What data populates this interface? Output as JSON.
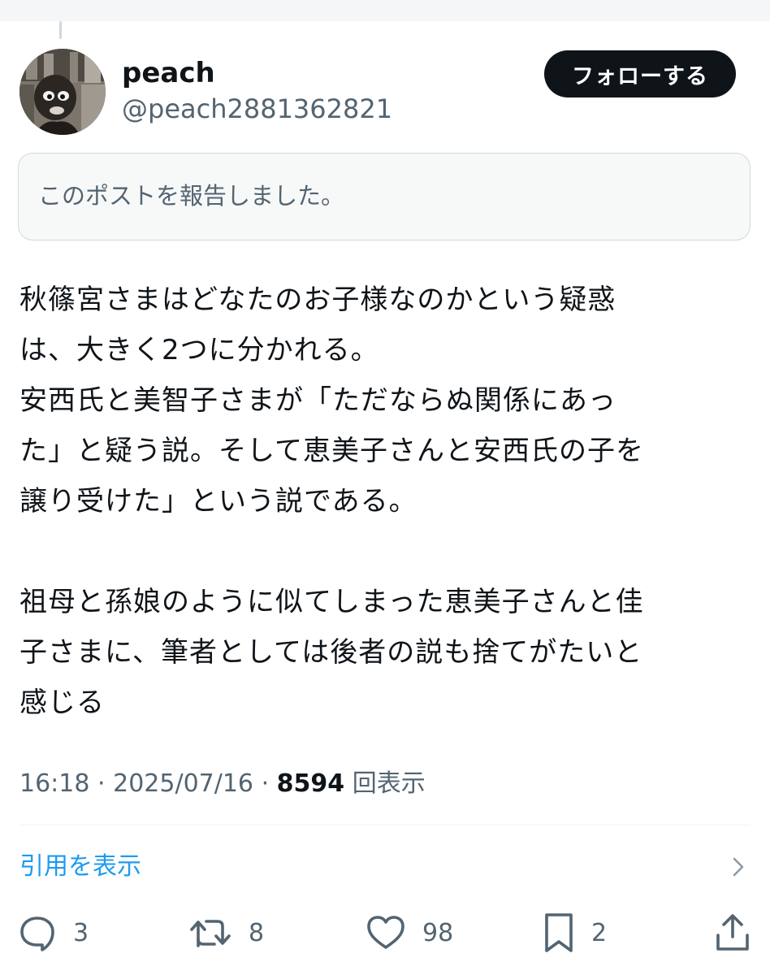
{
  "post": {
    "author": {
      "display_name": "peach",
      "handle": "@peach2881362821"
    },
    "follow_label": "フォローする",
    "report_notice": "このポストを報告しました。",
    "text_lines": [
      "秋篠宮さまはどなたのお子様なのかという疑惑",
      "は、大きく2つに分かれる。",
      "安西氏と美智子さまが「ただならぬ関係にあっ",
      "た」と疑う説。そして恵美子さんと安西氏の子を",
      "譲り受けた」という説である。",
      "",
      "祖母と孫娘のように似てしまった恵美子さんと佳",
      "子さまに、筆者としては後者の説も捨てがたいと",
      "感じる"
    ],
    "time": "16:18",
    "date": "2025/07/16",
    "separator": "·",
    "views_count": "8594",
    "views_label": "回表示",
    "quotes_label": "引用を表示"
  },
  "actions": {
    "replies": "3",
    "reposts": "8",
    "likes": "98",
    "bookmarks": "2"
  },
  "colors": {
    "text_primary": "#0f1419",
    "text_secondary": "#536471",
    "link": "#1d9bf0",
    "border": "#cfd9de",
    "notice_bg": "#f7f9f9"
  },
  "icons": [
    "reply-icon",
    "repost-icon",
    "like-icon",
    "bookmark-icon",
    "share-icon",
    "chevron-right-icon"
  ]
}
